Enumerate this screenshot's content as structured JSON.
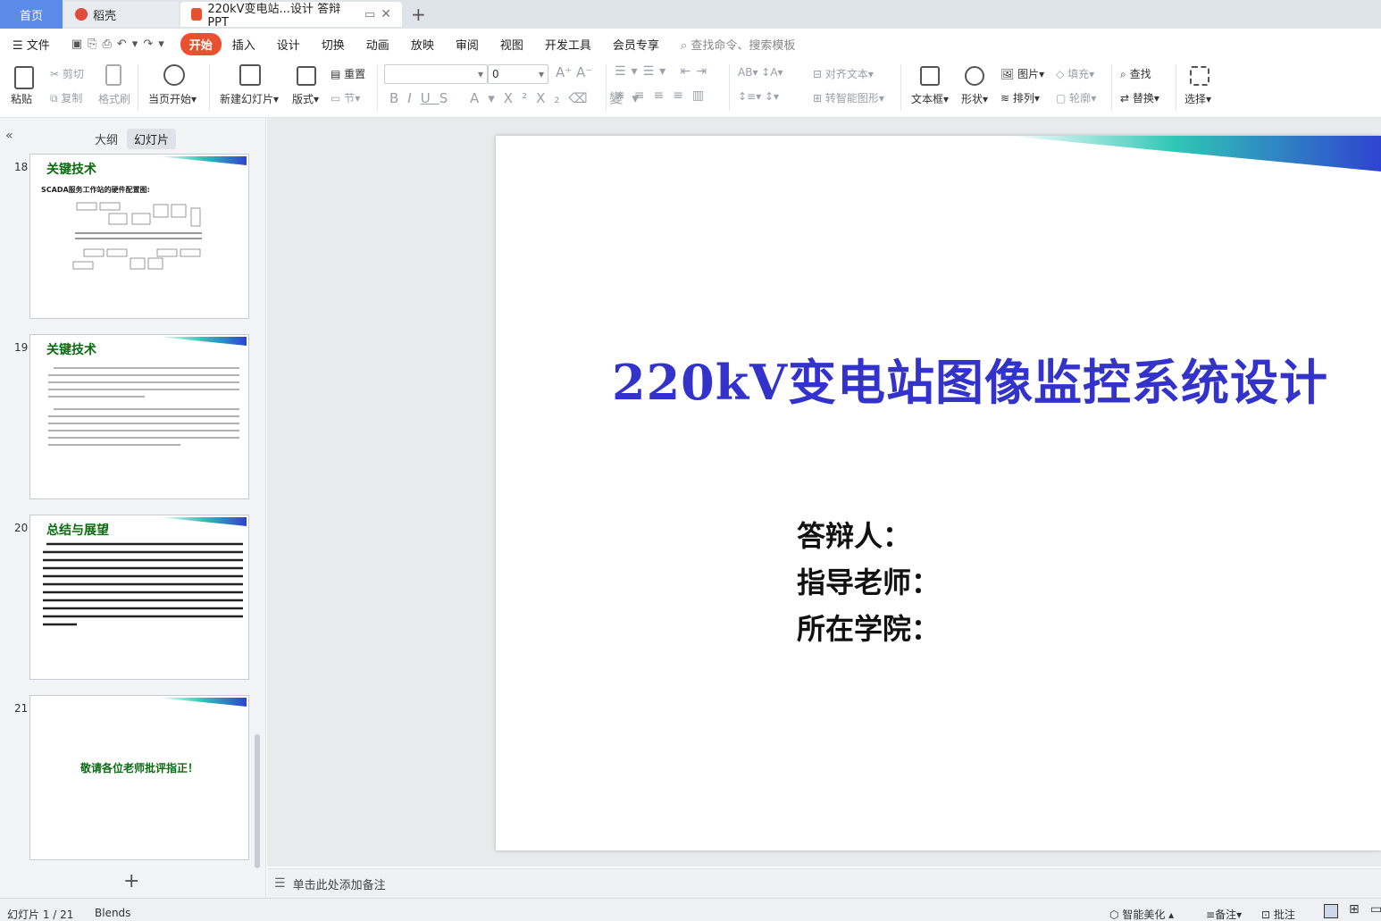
{
  "tabs": {
    "home": "首页",
    "daoke": "稻壳",
    "doc_title": "220kV变电站...设计 答辩PPT"
  },
  "menu": {
    "file": "文件",
    "items": [
      "开始",
      "插入",
      "设计",
      "切换",
      "动画",
      "放映",
      "审阅",
      "视图",
      "开发工具",
      "会员专享"
    ],
    "search_placeholder": "查找命令、搜索模板"
  },
  "ribbon": {
    "paste": "粘贴",
    "cut": "剪切",
    "copy": "复制",
    "format_painter": "格式刷",
    "play_from_current": "当页开始",
    "new_slide": "新建幻灯片",
    "layout": "版式",
    "reset": "重置",
    "section": "节",
    "font_size": "0",
    "align_text": "对齐文本",
    "to_smartart": "转智能图形",
    "textbox": "文本框",
    "shape": "形状",
    "picture": "图片",
    "arrange": "排列",
    "fill": "填充",
    "outline": "轮廓",
    "find": "查找",
    "replace": "替换",
    "select": "选择"
  },
  "left_panel": {
    "tab_outline": "大纲",
    "tab_slides": "幻灯片",
    "thumbs": [
      {
        "num": "18",
        "title": "关键技术",
        "subtitle": "SCADA服务工作站的硬件配置图:"
      },
      {
        "num": "19",
        "title": "关键技术"
      },
      {
        "num": "20",
        "title": "总结与展望"
      },
      {
        "num": "21",
        "text": "敬请各位老师批评指正！"
      }
    ]
  },
  "slide": {
    "title": "220kV变电站图像监控系统设计",
    "lines": [
      "答辩人：",
      "指导老师：",
      "所在学院："
    ]
  },
  "notes_placeholder": "单击此处添加备注",
  "status": {
    "slide_counter": "幻灯片 1 / 21",
    "theme": "Blends",
    "beautify": "智能美化",
    "notes": "备注",
    "comments": "批注"
  },
  "colors": {
    "accent": "#e8502f",
    "title_blue": "#3333cc",
    "thumb_title_green": "#0b6b11",
    "grad_teal": "#2fc7b5",
    "grad_blue": "#2f43d0"
  }
}
